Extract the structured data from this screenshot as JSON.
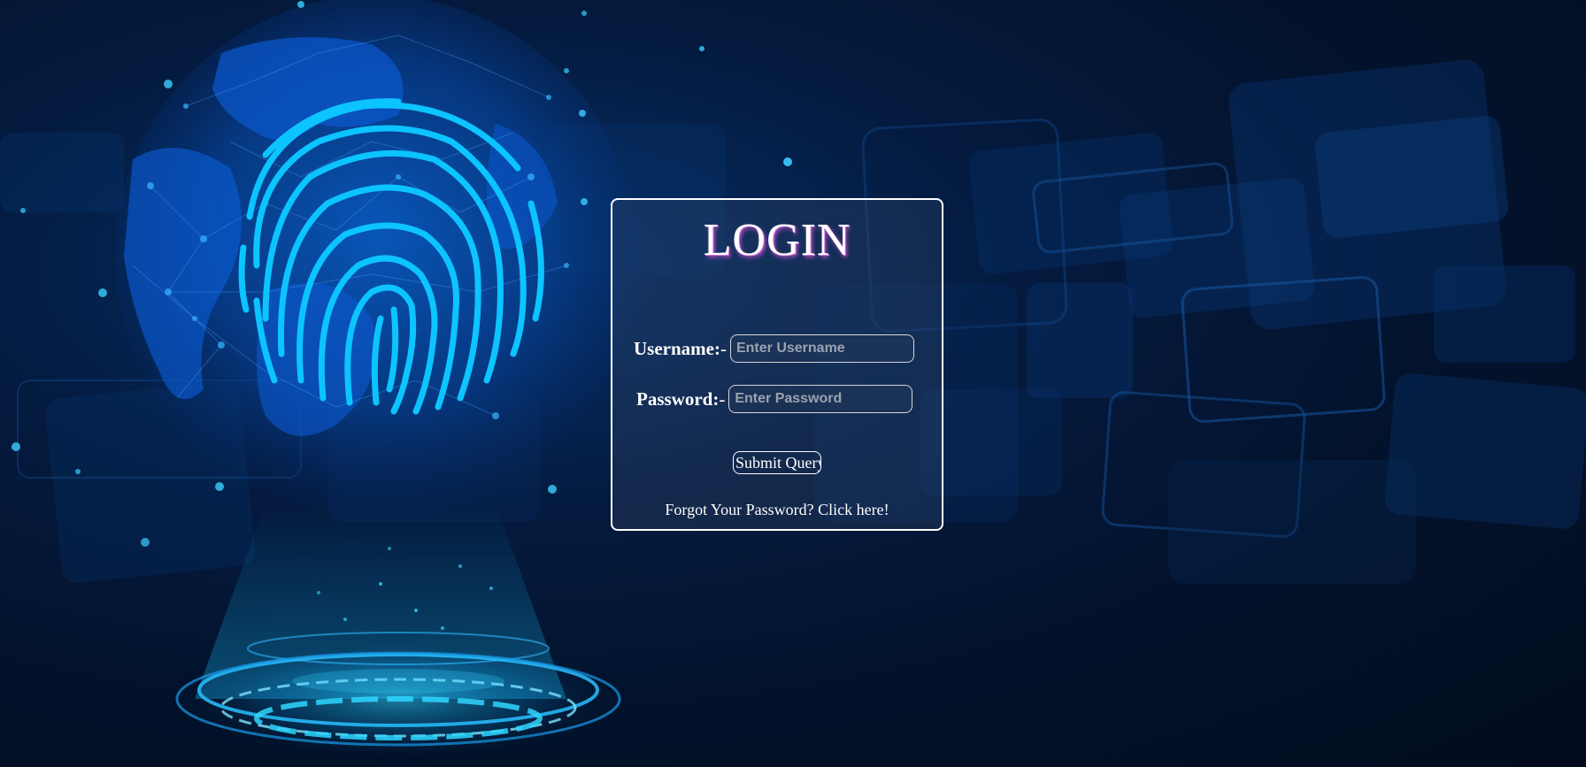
{
  "login": {
    "title": "LOGIN",
    "username_label": "Username:",
    "password_label": "Password:",
    "label_separator": "-",
    "username_placeholder": "Enter Username",
    "password_placeholder": "Enter Password",
    "submit_label": "Submit Query",
    "forgot_link": "Forgot Your Password? Click here!"
  },
  "background": {
    "icons": [
      "fingerprint-icon",
      "globe-icon",
      "hologram-platform-icon"
    ],
    "colors": {
      "base": "#031026",
      "accent": "#0cc4ff",
      "glow": "#16a8f0"
    }
  }
}
